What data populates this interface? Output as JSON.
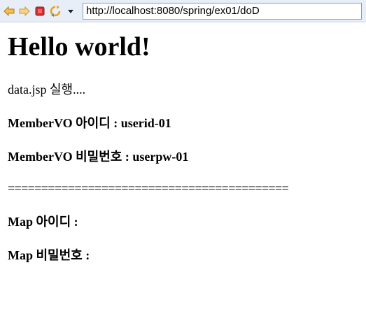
{
  "browser": {
    "url": "http://localhost:8080/spring/ex01/doD",
    "icons": [
      "back-arrow-icon",
      "forward-arrow-icon",
      "stop-icon",
      "refresh-icon",
      "dropdown-arrow-icon"
    ]
  },
  "page": {
    "heading": "Hello world!",
    "lines": [
      "data.jsp 실행....",
      "MemberVO 아이디 : userid-01",
      "MemberVO 비밀번호 : userpw-01",
      "==========================================",
      "Map 아이디 :",
      "Map 비밀번호 :"
    ]
  },
  "colors": {
    "toolbar_bg": "#e8eef7",
    "back_forward": "#e7a11a",
    "stop": "#d32f2f",
    "refresh": "#e7a11a"
  }
}
